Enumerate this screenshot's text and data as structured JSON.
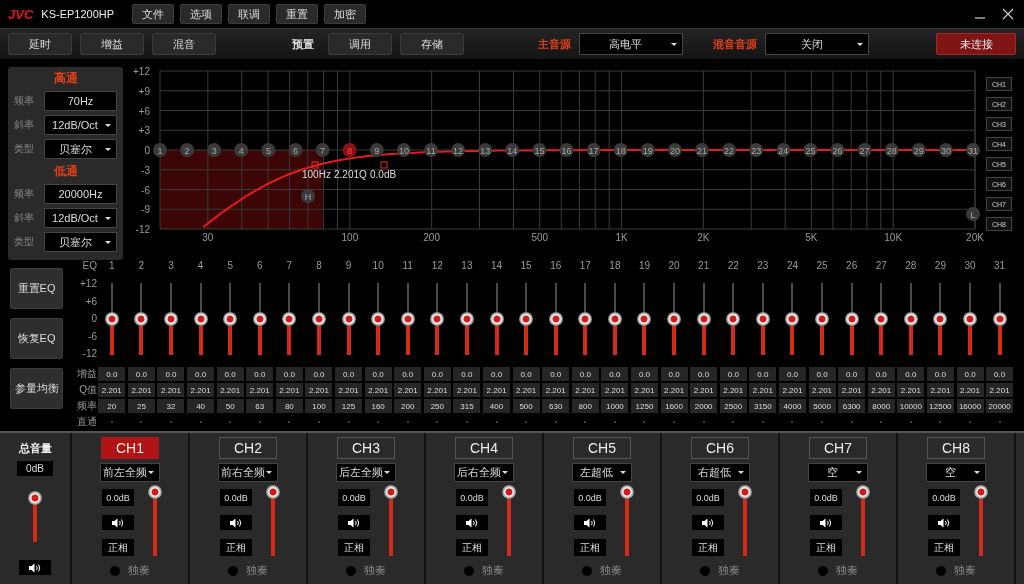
{
  "titlebar": {
    "logo": "JVC",
    "model": "KS-EP1200HP",
    "menu": [
      "文件",
      "选项",
      "联调",
      "重置",
      "加密"
    ]
  },
  "toolbar": {
    "buttons": [
      "延时",
      "增益",
      "混音"
    ],
    "preset_label": "预置",
    "preset_buttons": [
      "调用",
      "存储"
    ],
    "main_source": {
      "label": "主音源",
      "value": "高电平"
    },
    "mix_source": {
      "label": "混音音源",
      "value": "关闭"
    },
    "connection": "未连接"
  },
  "crossover": [
    {
      "title": "高通",
      "rows": [
        {
          "label": "频率",
          "value": "70Hz",
          "kind": "input"
        },
        {
          "label": "斜率",
          "value": "12dB/Oct",
          "kind": "select"
        },
        {
          "label": "类型",
          "value": "贝塞尔",
          "kind": "select"
        }
      ]
    },
    {
      "title": "低通",
      "rows": [
        {
          "label": "频率",
          "value": "20000Hz",
          "kind": "input"
        },
        {
          "label": "斜率",
          "value": "12dB/Oct",
          "kind": "select"
        },
        {
          "label": "类型",
          "value": "贝塞尔",
          "kind": "select"
        }
      ]
    }
  ],
  "graph": {
    "y_labels": [
      "+12",
      "+9",
      "+6",
      "+3",
      "0",
      "-3",
      "-6",
      "-9",
      "-12"
    ],
    "x_labels": [
      "30",
      "100",
      "200",
      "500",
      "1K",
      "2K",
      "5K",
      "10K",
      "20K"
    ],
    "nodes": [
      {
        "label": "1",
        "selected": false
      },
      {
        "label": "2",
        "selected": false
      },
      {
        "label": "3",
        "selected": false
      },
      {
        "label": "4",
        "selected": false
      },
      {
        "label": "5",
        "selected": false
      },
      {
        "label": "6",
        "selected": false
      },
      {
        "label": "7",
        "selected": false
      },
      {
        "label": "8",
        "selected": true
      },
      {
        "label": "9",
        "selected": false
      },
      {
        "label": "10",
        "selected": false
      },
      {
        "label": "11",
        "selected": false
      },
      {
        "label": "12",
        "selected": false
      },
      {
        "label": "13",
        "selected": false
      },
      {
        "label": "14",
        "selected": false
      },
      {
        "label": "15",
        "selected": false
      },
      {
        "label": "16",
        "selected": false
      },
      {
        "label": "17",
        "selected": false
      },
      {
        "label": "18",
        "selected": false
      },
      {
        "label": "19",
        "selected": false
      },
      {
        "label": "20",
        "selected": false
      },
      {
        "label": "21",
        "selected": false
      },
      {
        "label": "22",
        "selected": false
      },
      {
        "label": "23",
        "selected": false
      },
      {
        "label": "24",
        "selected": false
      },
      {
        "label": "25",
        "selected": false
      },
      {
        "label": "26",
        "selected": false
      },
      {
        "label": "27",
        "selected": false
      },
      {
        "label": "28",
        "selected": false
      },
      {
        "label": "29",
        "selected": false
      },
      {
        "label": "30",
        "selected": false
      },
      {
        "label": "31",
        "selected": false
      }
    ],
    "high_marker": "H",
    "low_marker": "L",
    "readout": [
      "100Hz",
      "2.201Q",
      "0.0dB"
    ],
    "channels": [
      {
        "label": "CH1",
        "selected": false
      },
      {
        "label": "CH2",
        "selected": false
      },
      {
        "label": "CH3",
        "selected": false
      },
      {
        "label": "CH4",
        "selected": false
      },
      {
        "label": "CH5",
        "selected": false
      },
      {
        "label": "CH6",
        "selected": false
      },
      {
        "label": "CH7",
        "selected": false
      },
      {
        "label": "CH8",
        "selected": false
      }
    ]
  },
  "eq": {
    "buttons": [
      "重置EQ",
      "恢复EQ",
      "参量均衡"
    ],
    "header": "EQ",
    "scale": [
      "+12",
      "+6",
      "0",
      "-6",
      "-12"
    ],
    "row_labels": [
      "增益",
      "Q值",
      "频率",
      "直通"
    ],
    "bands": [
      {
        "number": "1",
        "level": 0.5,
        "gain": "0.0",
        "q": "2.201",
        "freq": "20",
        "bypass": false
      },
      {
        "number": "2",
        "level": 0.5,
        "gain": "0.0",
        "q": "2.201",
        "freq": "25",
        "bypass": false
      },
      {
        "number": "3",
        "level": 0.5,
        "gain": "0.0",
        "q": "2.201",
        "freq": "32",
        "bypass": false
      },
      {
        "number": "4",
        "level": 0.5,
        "gain": "0.0",
        "q": "2.201",
        "freq": "40",
        "bypass": false
      },
      {
        "number": "5",
        "level": 0.5,
        "gain": "0.0",
        "q": "2.201",
        "freq": "50",
        "bypass": false
      },
      {
        "number": "6",
        "level": 0.5,
        "gain": "0.0",
        "q": "2.201",
        "freq": "63",
        "bypass": false
      },
      {
        "number": "7",
        "level": 0.5,
        "gain": "0.0",
        "q": "2.201",
        "freq": "80",
        "bypass": false
      },
      {
        "number": "8",
        "level": 0.5,
        "gain": "0.0",
        "q": "2.201",
        "freq": "100",
        "bypass": false
      },
      {
        "number": "9",
        "level": 0.5,
        "gain": "0.0",
        "q": "2.201",
        "freq": "125",
        "bypass": false
      },
      {
        "number": "10",
        "level": 0.5,
        "gain": "0.0",
        "q": "2.201",
        "freq": "160",
        "bypass": false
      },
      {
        "number": "11",
        "level": 0.5,
        "gain": "0.0",
        "q": "2.201",
        "freq": "200",
        "bypass": false
      },
      {
        "number": "12",
        "level": 0.5,
        "gain": "0.0",
        "q": "2.201",
        "freq": "250",
        "bypass": false
      },
      {
        "number": "13",
        "level": 0.5,
        "gain": "0.0",
        "q": "2.201",
        "freq": "315",
        "bypass": false
      },
      {
        "number": "14",
        "level": 0.5,
        "gain": "0.0",
        "q": "2.201",
        "freq": "400",
        "bypass": false
      },
      {
        "number": "15",
        "level": 0.5,
        "gain": "0.0",
        "q": "2.201",
        "freq": "500",
        "bypass": false
      },
      {
        "number": "16",
        "level": 0.5,
        "gain": "0.0",
        "q": "2.201",
        "freq": "630",
        "bypass": false
      },
      {
        "number": "17",
        "level": 0.5,
        "gain": "0.0",
        "q": "2.201",
        "freq": "800",
        "bypass": false
      },
      {
        "number": "18",
        "level": 0.5,
        "gain": "0.0",
        "q": "2.201",
        "freq": "1000",
        "bypass": false
      },
      {
        "number": "19",
        "level": 0.5,
        "gain": "0.0",
        "q": "2.201",
        "freq": "1250",
        "bypass": false
      },
      {
        "number": "20",
        "level": 0.5,
        "gain": "0.0",
        "q": "2.201",
        "freq": "1600",
        "bypass": false
      },
      {
        "number": "21",
        "level": 0.5,
        "gain": "0.0",
        "q": "2.201",
        "freq": "2000",
        "bypass": false
      },
      {
        "number": "22",
        "level": 0.5,
        "gain": "0.0",
        "q": "2.201",
        "freq": "2500",
        "bypass": false
      },
      {
        "number": "23",
        "level": 0.5,
        "gain": "0.0",
        "q": "2.201",
        "freq": "3150",
        "bypass": false
      },
      {
        "number": "24",
        "level": 0.5,
        "gain": "0.0",
        "q": "2.201",
        "freq": "4000",
        "bypass": false
      },
      {
        "number": "25",
        "level": 0.5,
        "gain": "0.0",
        "q": "2.201",
        "freq": "5000",
        "bypass": false
      },
      {
        "number": "26",
        "level": 0.5,
        "gain": "0.0",
        "q": "2.201",
        "freq": "6300",
        "bypass": false
      },
      {
        "number": "27",
        "level": 0.5,
        "gain": "0.0",
        "q": "2.201",
        "freq": "8000",
        "bypass": false
      },
      {
        "number": "28",
        "level": 0.5,
        "gain": "0.0",
        "q": "2.201",
        "freq": "10000",
        "bypass": false
      },
      {
        "number": "29",
        "level": 0.5,
        "gain": "0.0",
        "q": "2.201",
        "freq": "12500",
        "bypass": false
      },
      {
        "number": "30",
        "level": 0.5,
        "gain": "0.0",
        "q": "2.201",
        "freq": "16000",
        "bypass": false
      },
      {
        "number": "31",
        "level": 0.5,
        "gain": "0.0",
        "q": "2.201",
        "freq": "20000",
        "bypass": false
      }
    ]
  },
  "master": {
    "label": "总音量",
    "value": "0dB",
    "level": 0.95
  },
  "channels": [
    {
      "name": "CH1",
      "selected": true,
      "output": "前左全频",
      "gain": "0.0dB",
      "level": 1.0,
      "phase": "正相",
      "solo_label": "独奏",
      "solo": false
    },
    {
      "name": "CH2",
      "selected": false,
      "output": "前右全频",
      "gain": "0.0dB",
      "level": 1.0,
      "phase": "正相",
      "solo_label": "独奏",
      "solo": false
    },
    {
      "name": "CH3",
      "selected": false,
      "output": "后左全频",
      "gain": "0.0dB",
      "level": 1.0,
      "phase": "正相",
      "solo_label": "独奏",
      "solo": false
    },
    {
      "name": "CH4",
      "selected": false,
      "output": "后右全频",
      "gain": "0.0dB",
      "level": 1.0,
      "phase": "正相",
      "solo_label": "独奏",
      "solo": false
    },
    {
      "name": "CH5",
      "selected": false,
      "output": "左超低",
      "gain": "0.0dB",
      "level": 1.0,
      "phase": "正相",
      "solo_label": "独奏",
      "solo": false
    },
    {
      "name": "CH6",
      "selected": false,
      "output": "右超低",
      "gain": "0.0dB",
      "level": 1.0,
      "phase": "正相",
      "solo_label": "独奏",
      "solo": false
    },
    {
      "name": "CH7",
      "selected": false,
      "output": "空",
      "gain": "0.0dB",
      "level": 1.0,
      "phase": "正相",
      "solo_label": "独奏",
      "solo": false
    },
    {
      "name": "CH8",
      "selected": false,
      "output": "空",
      "gain": "0.0dB",
      "level": 1.0,
      "phase": "正相",
      "solo_label": "独奏",
      "solo": false
    }
  ]
}
